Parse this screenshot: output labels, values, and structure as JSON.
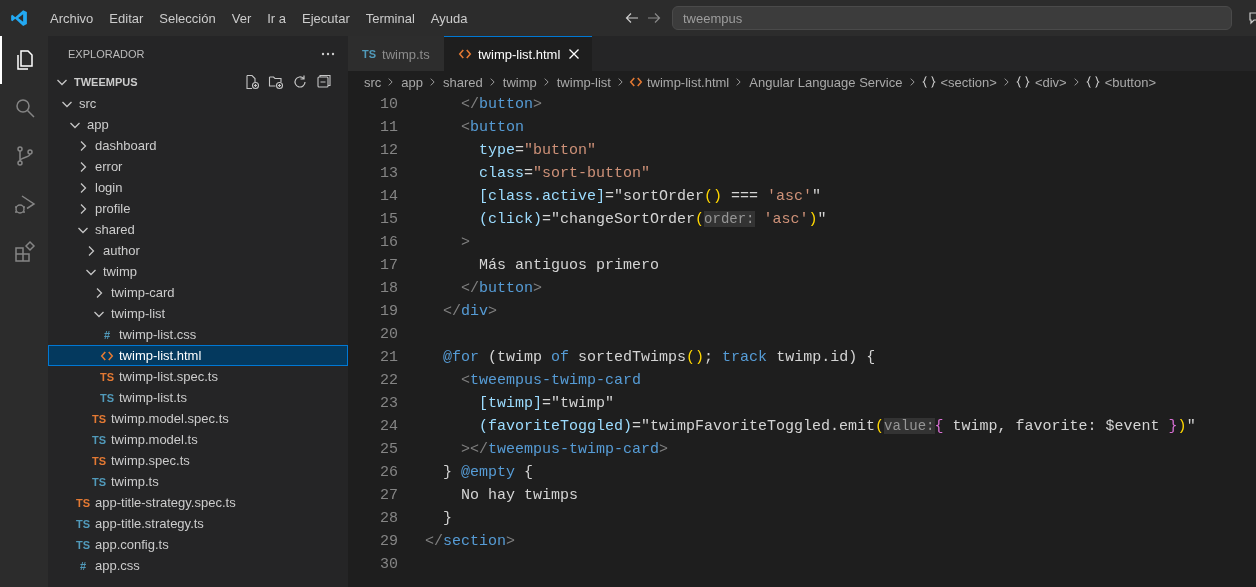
{
  "menu": [
    "Archivo",
    "Editar",
    "Selección",
    "Ver",
    "Ir a",
    "Ejecutar",
    "Terminal",
    "Ayuda"
  ],
  "command_center": {
    "text": "tweempus"
  },
  "activity_bar": [
    {
      "kind": "files",
      "selected": true
    },
    {
      "kind": "search",
      "selected": false
    },
    {
      "kind": "source-control",
      "selected": false
    },
    {
      "kind": "run-debug",
      "selected": false
    },
    {
      "kind": "extensions",
      "selected": false
    }
  ],
  "sidebar": {
    "title": "EXPLORADOR",
    "section": {
      "title": "TWEEMPUS",
      "expanded": true
    },
    "tree": [
      {
        "label": "src",
        "kind": "folder",
        "expanded": true,
        "selected": false,
        "children": [
          {
            "label": "app",
            "kind": "folder",
            "expanded": true,
            "selected": false,
            "children": [
              {
                "label": "dashboard",
                "kind": "folder",
                "expanded": false,
                "selected": false
              },
              {
                "label": "error",
                "kind": "folder",
                "expanded": false,
                "selected": false
              },
              {
                "label": "login",
                "kind": "folder",
                "expanded": false,
                "selected": false
              },
              {
                "label": "profile",
                "kind": "folder",
                "expanded": false,
                "selected": false
              },
              {
                "label": "shared",
                "kind": "folder",
                "expanded": true,
                "selected": false,
                "children": [
                  {
                    "label": "author",
                    "kind": "folder",
                    "expanded": false,
                    "selected": false
                  },
                  {
                    "label": "twimp",
                    "kind": "folder",
                    "expanded": true,
                    "selected": false,
                    "children": [
                      {
                        "label": "twimp-card",
                        "kind": "folder",
                        "expanded": false,
                        "selected": false
                      },
                      {
                        "label": "twimp-list",
                        "kind": "folder",
                        "expanded": true,
                        "selected": false,
                        "children": [
                          {
                            "label": "twimp-list.css",
                            "kind": "css",
                            "icon_text": "#",
                            "selected": false
                          },
                          {
                            "label": "twimp-list.html",
                            "kind": "html",
                            "selected": true
                          },
                          {
                            "label": "twimp-list.spec.ts",
                            "kind": "ts-spec",
                            "icon_text": "TS",
                            "selected": false
                          },
                          {
                            "label": "twimp-list.ts",
                            "kind": "ts",
                            "icon_text": "TS",
                            "selected": false
                          }
                        ]
                      },
                      {
                        "label": "twimp.model.spec.ts",
                        "kind": "ts-spec",
                        "icon_text": "TS",
                        "selected": false
                      },
                      {
                        "label": "twimp.model.ts",
                        "kind": "ts",
                        "icon_text": "TS",
                        "selected": false
                      },
                      {
                        "label": "twimp.spec.ts",
                        "kind": "ts-spec",
                        "icon_text": "TS",
                        "selected": false
                      },
                      {
                        "label": "twimp.ts",
                        "kind": "ts",
                        "icon_text": "TS",
                        "selected": false
                      }
                    ]
                  }
                ]
              },
              {
                "label": "app-title-strategy.spec.ts",
                "kind": "ts-spec",
                "icon_text": "TS",
                "selected": false
              },
              {
                "label": "app-title.strategy.ts",
                "kind": "ts",
                "icon_text": "TS",
                "selected": false
              },
              {
                "label": "app.config.ts",
                "kind": "ts",
                "icon_text": "TS",
                "selected": false
              },
              {
                "label": "app.css",
                "kind": "css",
                "icon_text": "#",
                "selected": false
              }
            ]
          }
        ]
      }
    ]
  },
  "tabs": [
    {
      "label": "twimp.ts",
      "kind": "ts",
      "icon_text": "TS",
      "selected": false
    },
    {
      "label": "twimp-list.html",
      "kind": "html",
      "selected": true
    }
  ],
  "breadcrumb": [
    {
      "text": "src",
      "kind": "folder"
    },
    {
      "text": "app",
      "kind": "folder"
    },
    {
      "text": "shared",
      "kind": "folder"
    },
    {
      "text": "twimp",
      "kind": "folder"
    },
    {
      "text": "twimp-list",
      "kind": "folder"
    },
    {
      "text": "twimp-list.html",
      "kind": "file"
    },
    {
      "text": "Angular Language Service",
      "kind": "service"
    },
    {
      "text": "<section>",
      "kind": "element"
    },
    {
      "text": "<div>",
      "kind": "element"
    },
    {
      "text": "<button>",
      "kind": "element"
    }
  ],
  "code": [
    {
      "number": "10",
      "tokens": [
        {
          "t": "    </",
          "kind": "punct"
        },
        {
          "t": "button",
          "kind": "tag"
        },
        {
          "t": ">",
          "kind": "punct"
        }
      ]
    },
    {
      "number": "11",
      "tokens": [
        {
          "t": "    <",
          "kind": "punct"
        },
        {
          "t": "button",
          "kind": "tag"
        }
      ]
    },
    {
      "number": "12",
      "tokens": [
        {
          "t": "      type",
          "kind": "attr"
        },
        {
          "t": "=",
          "kind": "plain"
        },
        {
          "t": "\"button\"",
          "kind": "string"
        }
      ]
    },
    {
      "number": "13",
      "tokens": [
        {
          "t": "      class",
          "kind": "attr"
        },
        {
          "t": "=",
          "kind": "plain"
        },
        {
          "t": "\"sort-button\"",
          "kind": "string"
        }
      ]
    },
    {
      "number": "14",
      "tokens": [
        {
          "t": "      [class.active]",
          "kind": "attr"
        },
        {
          "t": "=\"sortOrder",
          "kind": "plain"
        },
        {
          "t": "()",
          "kind": "yellow"
        },
        {
          "t": " === ",
          "kind": "plain"
        },
        {
          "t": "'asc'",
          "kind": "string"
        },
        {
          "t": "\"",
          "kind": "plain"
        }
      ]
    },
    {
      "number": "15",
      "tokens": [
        {
          "t": "      (click)",
          "kind": "attr"
        },
        {
          "t": "=\"changeSortOrder",
          "kind": "plain"
        },
        {
          "t": "(",
          "kind": "yellow"
        },
        {
          "t": "order:",
          "kind": "hint"
        },
        {
          "t": " 'asc'",
          "kind": "string"
        },
        {
          "t": ")",
          "kind": "yellow"
        },
        {
          "t": "\"",
          "kind": "plain"
        }
      ]
    },
    {
      "number": "16",
      "tokens": [
        {
          "t": "    >",
          "kind": "punct"
        }
      ]
    },
    {
      "number": "17",
      "tokens": [
        {
          "t": "      Más antiguos primero",
          "kind": "plain"
        }
      ]
    },
    {
      "number": "18",
      "tokens": [
        {
          "t": "    </",
          "kind": "punct"
        },
        {
          "t": "button",
          "kind": "tag"
        },
        {
          "t": ">",
          "kind": "punct"
        }
      ]
    },
    {
      "number": "19",
      "tokens": [
        {
          "t": "  </",
          "kind": "punct"
        },
        {
          "t": "div",
          "kind": "tag"
        },
        {
          "t": ">",
          "kind": "punct"
        }
      ]
    },
    {
      "number": "20"
    },
    {
      "number": "21",
      "tokens": [
        {
          "t": "  @for",
          "kind": "keyword"
        },
        {
          "t": " (twimp ",
          "kind": "plain"
        },
        {
          "t": "of",
          "kind": "keyword"
        },
        {
          "t": " sortedTwimps",
          "kind": "plain"
        },
        {
          "t": "()",
          "kind": "yellow"
        },
        {
          "t": "; ",
          "kind": "plain"
        },
        {
          "t": "track",
          "kind": "keyword"
        },
        {
          "t": " twimp.id) {",
          "kind": "plain"
        }
      ]
    },
    {
      "number": "22",
      "tokens": [
        {
          "t": "    <",
          "kind": "punct"
        },
        {
          "t": "tweempus-twimp-card",
          "kind": "tag"
        }
      ]
    },
    {
      "number": "23",
      "tokens": [
        {
          "t": "      [twimp]",
          "kind": "attr"
        },
        {
          "t": "=\"twimp\"",
          "kind": "plain"
        }
      ]
    },
    {
      "number": "24",
      "tokens": [
        {
          "t": "      (favoriteToggled)",
          "kind": "attr"
        },
        {
          "t": "=\"twimpFavoriteToggled.emit",
          "kind": "plain"
        },
        {
          "t": "(",
          "kind": "yellow"
        },
        {
          "t": "value:",
          "kind": "hint"
        },
        {
          "t": "{",
          "kind": "purple"
        },
        {
          "t": " twimp, favorite: $event ",
          "kind": "plain"
        },
        {
          "t": "}",
          "kind": "purple"
        },
        {
          "t": ")",
          "kind": "yellow"
        },
        {
          "t": "\"",
          "kind": "plain"
        }
      ]
    },
    {
      "number": "25",
      "tokens": [
        {
          "t": "    ></",
          "kind": "punct"
        },
        {
          "t": "tweempus-twimp-card",
          "kind": "tag"
        },
        {
          "t": ">",
          "kind": "punct"
        }
      ]
    },
    {
      "number": "26",
      "tokens": [
        {
          "t": "  } ",
          "kind": "plain"
        },
        {
          "t": "@empty",
          "kind": "keyword"
        },
        {
          "t": " {",
          "kind": "plain"
        }
      ]
    },
    {
      "number": "27",
      "tokens": [
        {
          "t": "    No hay twimps",
          "kind": "plain"
        }
      ]
    },
    {
      "number": "28",
      "tokens": [
        {
          "t": "  }",
          "kind": "plain"
        }
      ]
    },
    {
      "number": "29",
      "tokens": [
        {
          "t": "</",
          "kind": "punct"
        },
        {
          "t": "section",
          "kind": "tag"
        },
        {
          "t": ">",
          "kind": "punct"
        }
      ]
    },
    {
      "number": "30"
    }
  ]
}
